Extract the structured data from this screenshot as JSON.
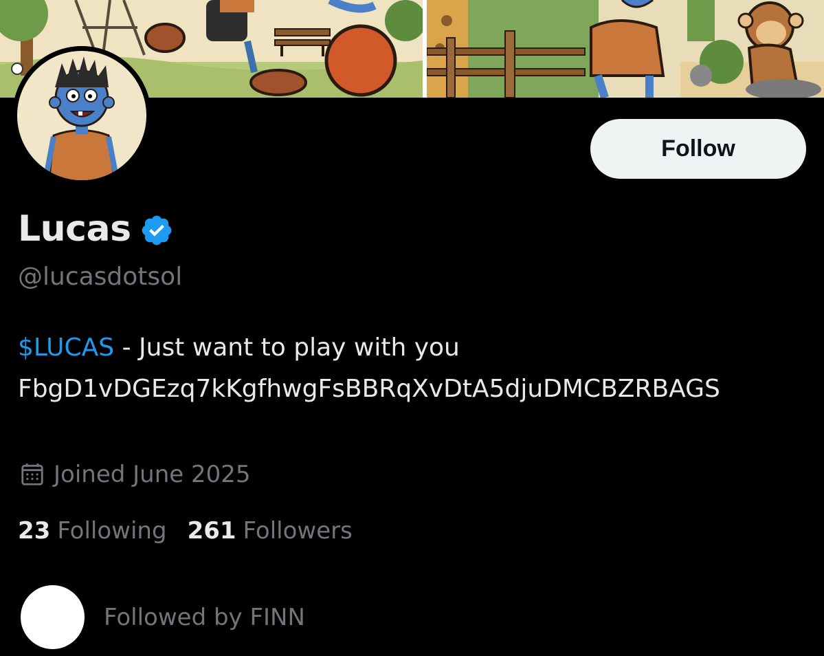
{
  "banner": {
    "description_icon": "cartoon-banner-image"
  },
  "profile": {
    "display_name": "Lucas",
    "handle": "@lucasdotsol",
    "verified_icon": "verified-badge-icon",
    "verified_color": "#1d9bf0",
    "follow_label": "Follow"
  },
  "bio": {
    "cashtag": "$LUCAS",
    "text": " - Just want to play with you",
    "address": "FbgD1vDGEzq7kKgfhwgFsBBRqXvDtA5djuDMCBZRBAGS"
  },
  "joined": {
    "icon": "calendar-icon",
    "text": "Joined June 2025"
  },
  "stats": {
    "following_count": "23",
    "following_label": "Following",
    "followers_count": "261",
    "followers_label": "Followers"
  },
  "followed_by": {
    "text": "Followed by FINN"
  },
  "colors": {
    "background": "#000000",
    "primary_text": "#e7e9ea",
    "secondary_text": "#71767b",
    "accent": "#1d9bf0",
    "button_bg": "#eff3f4"
  }
}
